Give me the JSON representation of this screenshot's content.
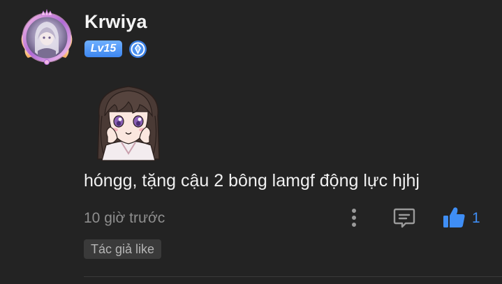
{
  "user": {
    "name": "Krwiya",
    "level": "Lv15"
  },
  "comment": {
    "text": "hóngg, tặng cậu 2 bông lamgf động lực hjhj",
    "time": "10 giờ trước",
    "likes": "1",
    "author_tag": "Tác giả like"
  },
  "icons": {
    "avatar": "avatar-with-frame",
    "rank": "diamond-rank-icon",
    "more": "more-vertical-icon",
    "reply": "comment-reply-icon",
    "like": "thumbs-up-icon"
  },
  "colors": {
    "background": "#232323",
    "accent": "#3f8ef5",
    "text": "#f0f0f0",
    "muted": "#8e8e8e"
  }
}
